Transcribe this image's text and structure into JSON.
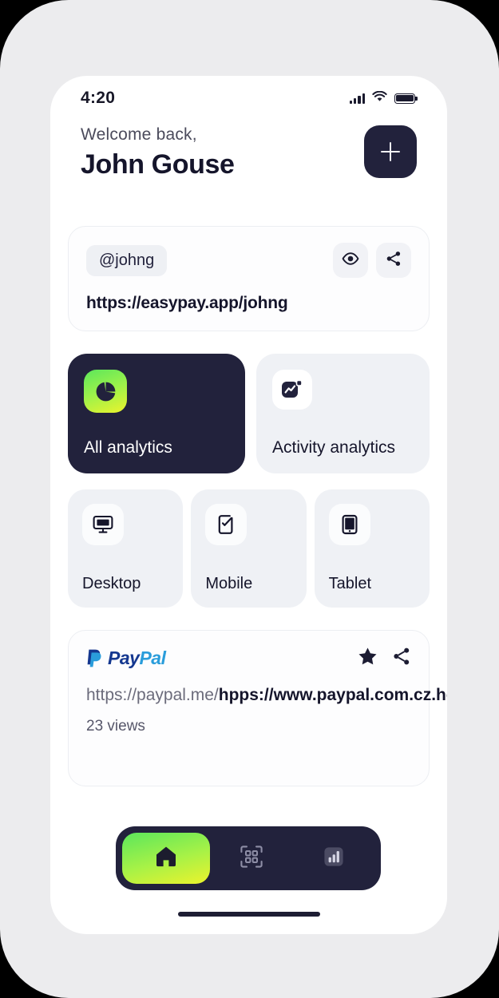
{
  "status_bar": {
    "time": "4:20",
    "signal_icon": "cellular-signal-icon",
    "wifi_icon": "wifi-icon",
    "battery_icon": "battery-full-icon"
  },
  "header": {
    "welcome_text": "Welcome back,",
    "user_name": "John Gouse",
    "add_button_label": "+",
    "add_button_icon": "plus-icon"
  },
  "profile_card": {
    "handle": "@johng",
    "url": "https://easypay.app/johng",
    "preview_icon": "eye-icon",
    "share_icon": "share-icon"
  },
  "analytics": [
    {
      "label": "All analytics",
      "icon": "pie-chart-icon",
      "active": true
    },
    {
      "label": "Activity analytics",
      "icon": "line-chart-icon",
      "active": false
    }
  ],
  "devices": [
    {
      "label": "Desktop",
      "icon": "desktop-monitor-icon"
    },
    {
      "label": "Mobile",
      "icon": "mobile-check-icon"
    },
    {
      "label": "Tablet",
      "icon": "tablet-icon"
    }
  ],
  "link_card": {
    "brand": "PayPal",
    "brand_part_1": "Pay",
    "brand_part_2": "Pal",
    "brand_icon": "paypal-logo-icon",
    "favorite_icon": "star-icon",
    "share_icon": "share-icon",
    "url_prefix": "https://paypal.me/",
    "url_main": "hpps://www.paypal.com.cz.home",
    "views": "23 views"
  },
  "bottom_nav": [
    {
      "label": "Home",
      "icon": "home-icon",
      "active": true
    },
    {
      "label": "Scan",
      "icon": "qr-code-icon",
      "active": false
    },
    {
      "label": "Stats",
      "icon": "bar-chart-icon",
      "active": false
    }
  ],
  "colors": {
    "accent_green": "#5ce65c",
    "accent_yellow": "#ecf32c",
    "dark": "#22223c",
    "surface": "#eff1f5",
    "paypal_dark": "#14378f",
    "paypal_light": "#2a9ddb"
  }
}
